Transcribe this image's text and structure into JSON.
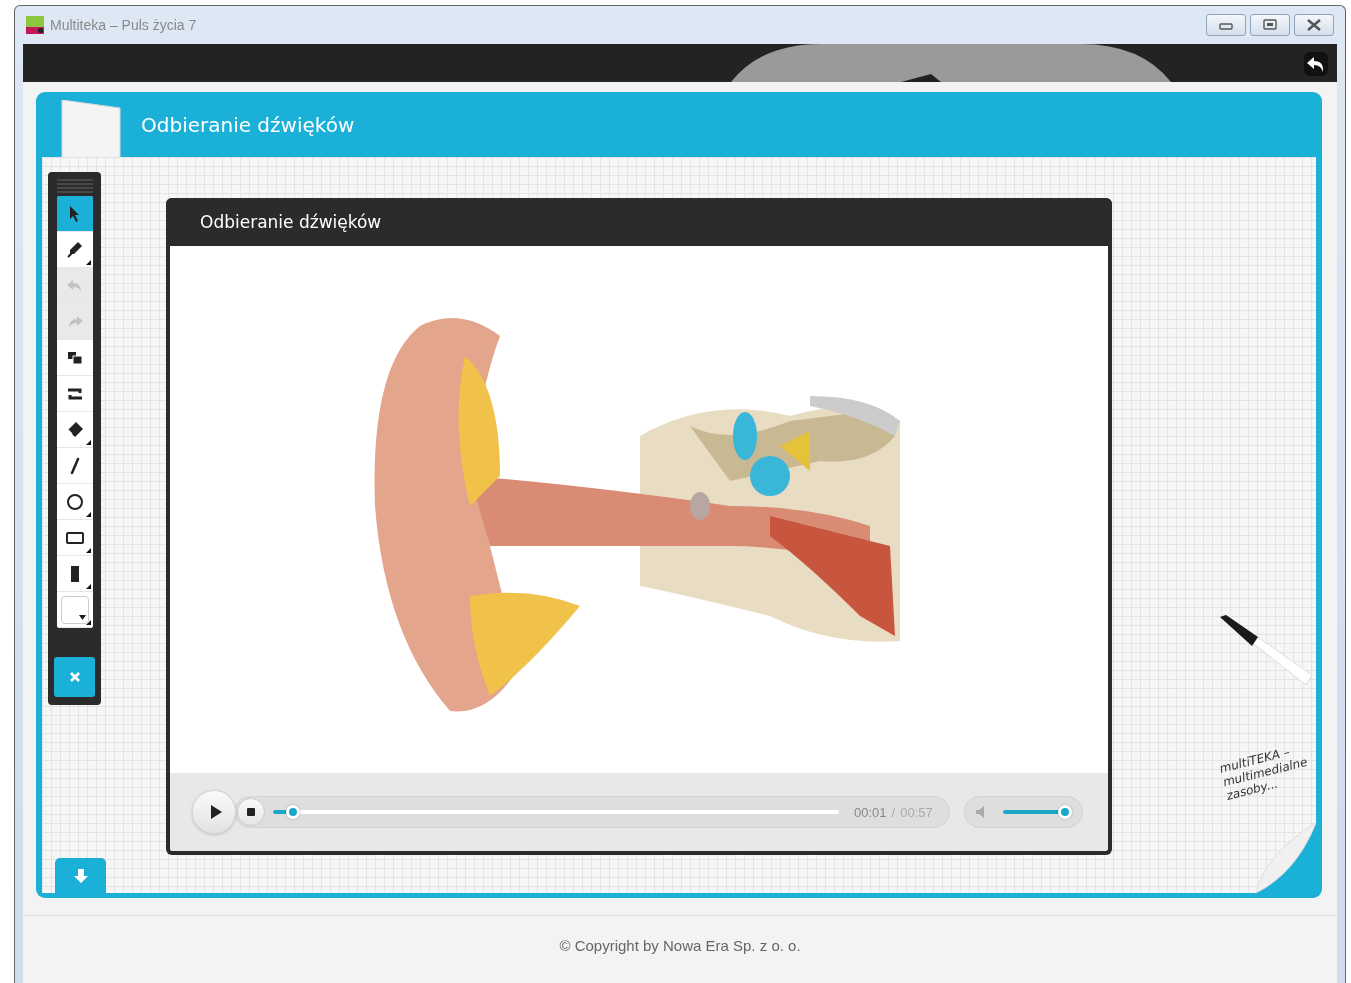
{
  "window": {
    "title": "Multiteka – Puls życia 7",
    "controls": [
      {
        "kind": "minimize"
      },
      {
        "kind": "maximize"
      },
      {
        "kind": "close"
      }
    ]
  },
  "lesson": {
    "title": "Odbieranie dźwięków"
  },
  "toolbar": {
    "tools": [
      {
        "kind": "select",
        "selected": true,
        "disabled": false,
        "submenu": false
      },
      {
        "kind": "pen",
        "selected": false,
        "disabled": false,
        "submenu": true
      },
      {
        "kind": "undo",
        "selected": false,
        "disabled": true,
        "submenu": false
      },
      {
        "kind": "redo",
        "selected": false,
        "disabled": true,
        "submenu": false
      },
      {
        "kind": "layers",
        "selected": false,
        "disabled": false,
        "submenu": false
      },
      {
        "kind": "swap",
        "selected": false,
        "disabled": false,
        "submenu": false
      },
      {
        "kind": "eraser",
        "selected": false,
        "disabled": false,
        "submenu": true
      },
      {
        "kind": "line",
        "selected": false,
        "disabled": false,
        "submenu": false
      },
      {
        "kind": "circle",
        "selected": false,
        "disabled": false,
        "submenu": true
      },
      {
        "kind": "rectangle",
        "selected": false,
        "disabled": false,
        "submenu": true
      },
      {
        "kind": "marker",
        "selected": false,
        "disabled": false,
        "submenu": true
      },
      {
        "kind": "color",
        "selected": false,
        "disabled": false,
        "submenu": true
      }
    ]
  },
  "video": {
    "title": "Odbieranie dźwięków",
    "player": {
      "playing": false,
      "progress": {
        "level": 0.035
      },
      "time_current": "00:01",
      "time_separator": "/",
      "time_total": "00:57",
      "volume": {
        "level": 1.0
      }
    }
  },
  "note": {
    "text": "multiTEKA –\nmultimedialne\nzasoby..."
  },
  "footer": {
    "copyright": "© Copyright by Nowa Era Sp. z o. o."
  }
}
